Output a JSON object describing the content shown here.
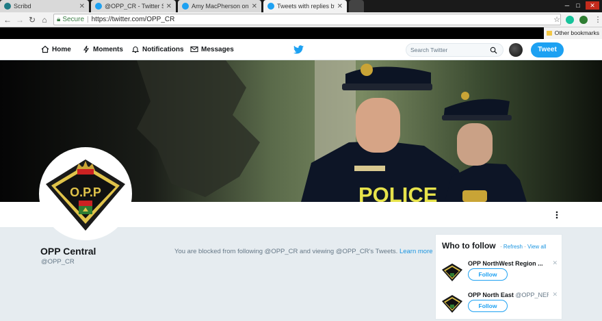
{
  "browser": {
    "tabs": [
      {
        "title": "Scribd",
        "icon": "scribd-icon",
        "active": false
      },
      {
        "title": "@OPP_CR - Twitter Sear",
        "icon": "twitter-bird-icon",
        "active": false
      },
      {
        "title": "Amy MacPherson on Twi",
        "icon": "twitter-bird-icon",
        "active": false
      },
      {
        "title": "Tweets with replies by O",
        "icon": "twitter-bird-icon",
        "active": true
      }
    ],
    "address": {
      "secure_label": "Secure",
      "url": "https://twitter.com/OPP_CR"
    },
    "bookmarks": {
      "other_label": "Other bookmarks"
    },
    "colors": {
      "secure": "#3a7d44"
    }
  },
  "twitter_nav": {
    "home": "Home",
    "moments": "Moments",
    "notifications": "Notifications",
    "messages": "Messages",
    "search_placeholder": "Search Twitter",
    "tweet_button": "Tweet"
  },
  "banner": {
    "vest_text": "POLICE"
  },
  "profile": {
    "name": "OPP Central",
    "handle": "@OPP_CR",
    "logo_text": "O.P.P",
    "blocked_message": "You are blocked from following @OPP_CR and viewing @OPP_CR's Tweets.",
    "learn_more": "Learn more"
  },
  "who_to_follow": {
    "title": "Who to follow",
    "sep1": " · ",
    "refresh": "Refresh",
    "sep2": " · ",
    "view_all": "View all",
    "suggestions": [
      {
        "name": "OPP NorthWest Region ...",
        "handle": "",
        "follow_label": "Follow"
      },
      {
        "name": "OPP North East",
        "handle": "@OPP_NER",
        "follow_label": "Follow"
      }
    ]
  },
  "colors": {
    "twitter_blue": "#1da1f2",
    "link_blue": "#1b95e0",
    "page_bg": "#e6ecf0"
  }
}
